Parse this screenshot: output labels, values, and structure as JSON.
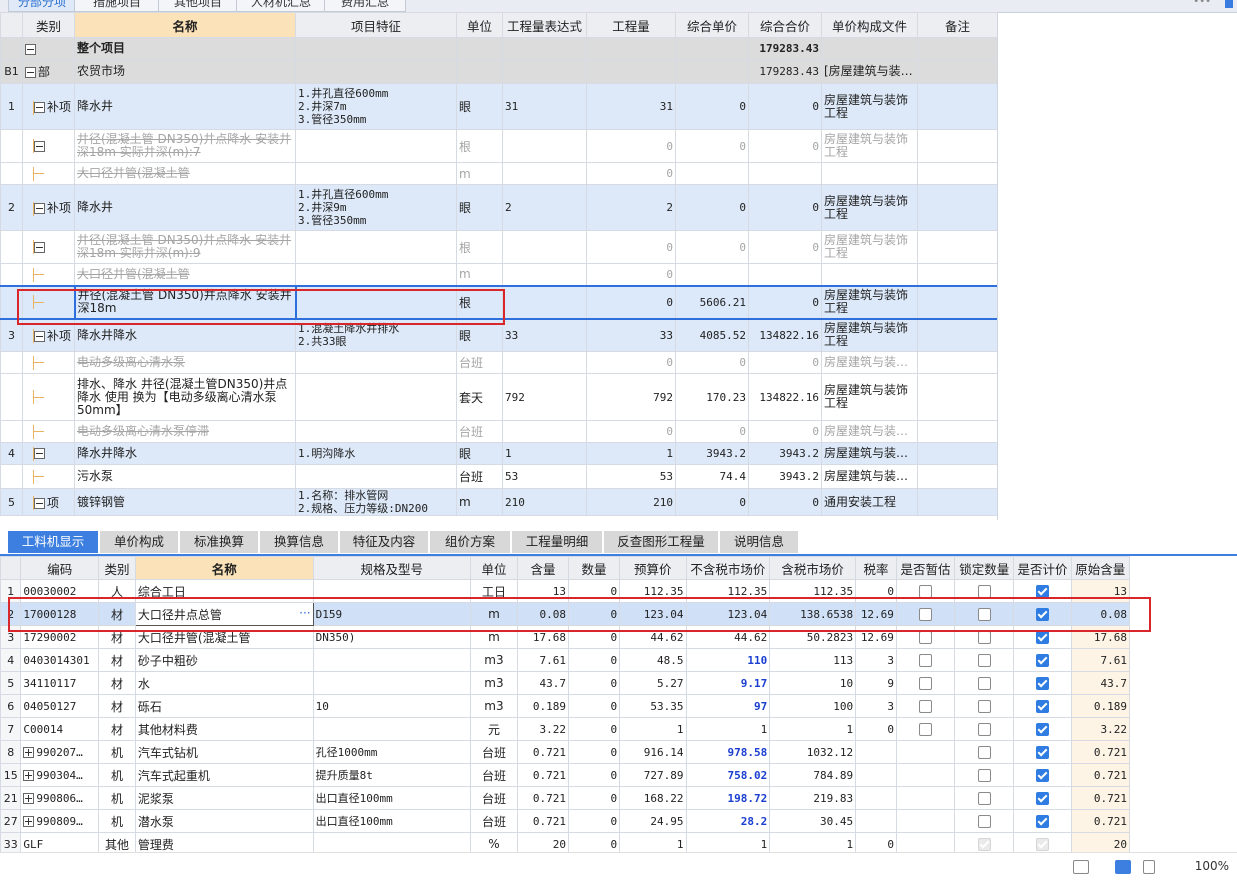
{
  "top_tabs": [
    "分部分项",
    "措施项目",
    "其他项目",
    "人材机汇总",
    "费用汇总"
  ],
  "upper": {
    "headers": [
      "类别",
      "名称",
      "项目特征",
      "单位",
      "工程量表达式",
      "工程量",
      "综合单价",
      "综合合价",
      "单价构成文件",
      "备注"
    ],
    "rows": [
      {
        "idx": "",
        "cat": "",
        "name": "整个项目",
        "feat": "",
        "unit": "",
        "expr": "",
        "qty": "",
        "price": "",
        "total": "179283.43",
        "file": "",
        "style": "gray"
      },
      {
        "idx": "B1",
        "cat": "部",
        "name": "农贸市场",
        "feat": "",
        "unit": "",
        "expr": "",
        "qty": "",
        "price": "",
        "total": "179283.43",
        "file": "[房屋建筑与装…",
        "style": "gray"
      },
      {
        "idx": "1",
        "cat": "补项",
        "name": "降水井",
        "feat": "1.井孔直径600mm\n2.井深7m\n3.管径350mm",
        "unit": "眼",
        "expr": "31",
        "qty": "31",
        "price": "0",
        "total": "0",
        "file": "房屋建筑与装饰工程",
        "style": "blue"
      },
      {
        "idx": "",
        "cat": "",
        "name": "井径(混凝土管 DN350)井点降水 安装井深18m  实际井深(m):7",
        "feat": "",
        "unit": "根",
        "expr": "",
        "qty": "0",
        "price": "0",
        "total": "0",
        "file": "房屋建筑与装饰工程",
        "style": "dis"
      },
      {
        "idx": "",
        "cat": "",
        "name": "大口径井管(混凝土管",
        "feat": "",
        "unit": "m",
        "expr": "",
        "qty": "0",
        "price": "",
        "total": "",
        "file": "",
        "style": "dis"
      },
      {
        "idx": "2",
        "cat": "补项",
        "name": "降水井",
        "feat": "1.井孔直径600mm\n2.井深9m\n3.管径350mm",
        "unit": "眼",
        "expr": "2",
        "qty": "2",
        "price": "0",
        "total": "0",
        "file": "房屋建筑与装饰工程",
        "style": "blue"
      },
      {
        "idx": "",
        "cat": "",
        "name": "井径(混凝土管 DN350)井点降水 安装井深18m  实际井深(m):9",
        "feat": "",
        "unit": "根",
        "expr": "",
        "qty": "0",
        "price": "0",
        "total": "0",
        "file": "房屋建筑与装饰工程",
        "style": "dis"
      },
      {
        "idx": "",
        "cat": "",
        "name": "大口径井管(混凝土管",
        "feat": "",
        "unit": "m",
        "expr": "",
        "qty": "0",
        "price": "",
        "total": "",
        "file": "",
        "style": "dis"
      },
      {
        "idx": "",
        "cat": "",
        "name": "井径(混凝土管 DN350)井点降水 安装井深18m",
        "feat": "",
        "unit": "根",
        "expr": "",
        "qty": "0",
        "price": "5606.21",
        "total": "0",
        "file": "房屋建筑与装饰工程",
        "style": "selrow"
      },
      {
        "idx": "3",
        "cat": "补项",
        "name": "降水井降水",
        "feat": "1.混凝土降水井排水\n2.共33眼",
        "unit": "眼",
        "expr": "33",
        "qty": "33",
        "price": "4085.52",
        "total": "134822.16",
        "file": "房屋建筑与装饰工程",
        "style": "blue"
      },
      {
        "idx": "",
        "cat": "",
        "name": "电动多级离心清水泵",
        "feat": "",
        "unit": "台班",
        "expr": "",
        "qty": "0",
        "price": "0",
        "total": "0",
        "file": "房屋建筑与装…",
        "style": "dis"
      },
      {
        "idx": "",
        "cat": "",
        "name": "排水、降水 井径(混凝土管DN350)井点降水 使用  换为【电动多级离心清水泵 50mm】",
        "feat": "",
        "unit": "套天",
        "expr": "792",
        "qty": "792",
        "price": "170.23",
        "total": "134822.16",
        "file": "房屋建筑与装饰工程",
        "style": "white"
      },
      {
        "idx": "",
        "cat": "",
        "name": "电动多级离心清水泵停滞",
        "feat": "",
        "unit": "台班",
        "expr": "",
        "qty": "0",
        "price": "0",
        "total": "0",
        "file": "房屋建筑与装…",
        "style": "dis"
      },
      {
        "idx": "4",
        "cat": "",
        "name": "降水井降水",
        "feat": "1.明沟降水",
        "unit": "眼",
        "expr": "1",
        "qty": "1",
        "price": "3943.2",
        "total": "3943.2",
        "file": "房屋建筑与装…",
        "style": "blue"
      },
      {
        "idx": "",
        "cat": "",
        "name": "污水泵",
        "feat": "",
        "unit": "台班",
        "expr": "53",
        "qty": "53",
        "price": "74.4",
        "total": "3943.2",
        "file": "房屋建筑与装…",
        "style": "white"
      },
      {
        "idx": "5",
        "cat": "项",
        "name": "镀锌钢管",
        "feat": "1.名称：排水管网\n2.规格、压力等级:DN200",
        "unit": "m",
        "expr": "210",
        "qty": "210",
        "price": "0",
        "total": "0",
        "file": "通用安装工程",
        "style": "blue"
      }
    ]
  },
  "bottom_tabs": [
    "工料机显示",
    "单价构成",
    "标准换算",
    "换算信息",
    "特征及内容",
    "组价方案",
    "工程量明细",
    "反查图形工程量",
    "说明信息"
  ],
  "lower": {
    "headers": [
      "编码",
      "类别",
      "名称",
      "规格及型号",
      "单位",
      "含量",
      "数量",
      "预算价",
      "不含税市场价",
      "含税市场价",
      "税率",
      "是否暂估",
      "锁定数量",
      "是否计价",
      "原始含量"
    ],
    "rows": [
      {
        "idx": "1",
        "code": "00030002",
        "cat": "人",
        "name": "综合工日",
        "spec": "",
        "unit": "工日",
        "content": "13",
        "qty": "0",
        "budget": "112.35",
        "ntax": "112.35",
        "tax": "112.35",
        "rate": "0",
        "est": false,
        "lock": false,
        "price": true,
        "orig": "13",
        "bold": false,
        "plus": false
      },
      {
        "idx": "2",
        "code": "17000128",
        "cat": "材",
        "name": "大口径井点总管",
        "spec": "D159",
        "unit": "m",
        "content": "0.08",
        "qty": "0",
        "budget": "123.04",
        "ntax": "123.04",
        "tax": "138.6538",
        "rate": "12.69",
        "est": false,
        "lock": false,
        "price": true,
        "orig": "0.08",
        "bold": false,
        "plus": false
      },
      {
        "idx": "3",
        "code": "17290002",
        "cat": "材",
        "name": "大口径井管(混凝土管",
        "spec": "DN350)",
        "unit": "m",
        "content": "17.68",
        "qty": "0",
        "budget": "44.62",
        "ntax": "44.62",
        "tax": "50.2823",
        "rate": "12.69",
        "est": false,
        "lock": false,
        "price": true,
        "orig": "17.68",
        "bold": false,
        "plus": false
      },
      {
        "idx": "4",
        "code": "0403014301",
        "cat": "材",
        "name": "砂子中粗砂",
        "spec": "",
        "unit": "m3",
        "content": "7.61",
        "qty": "0",
        "budget": "48.5",
        "ntax": "110",
        "tax": "113",
        "rate": "3",
        "est": false,
        "lock": false,
        "price": true,
        "orig": "7.61",
        "bold": true,
        "plus": false
      },
      {
        "idx": "5",
        "code": "34110117",
        "cat": "材",
        "name": "水",
        "spec": "",
        "unit": "m3",
        "content": "43.7",
        "qty": "0",
        "budget": "5.27",
        "ntax": "9.17",
        "tax": "10",
        "rate": "9",
        "est": false,
        "lock": false,
        "price": true,
        "orig": "43.7",
        "bold": true,
        "plus": false
      },
      {
        "idx": "6",
        "code": "04050127",
        "cat": "材",
        "name": "砾石",
        "spec": "10",
        "unit": "m3",
        "content": "0.189",
        "qty": "0",
        "budget": "53.35",
        "ntax": "97",
        "tax": "100",
        "rate": "3",
        "est": false,
        "lock": false,
        "price": true,
        "orig": "0.189",
        "bold": true,
        "plus": false
      },
      {
        "idx": "7",
        "code": "C00014",
        "cat": "材",
        "name": "其他材料费",
        "spec": "",
        "unit": "元",
        "content": "3.22",
        "qty": "0",
        "budget": "1",
        "ntax": "1",
        "tax": "1",
        "rate": "0",
        "est": false,
        "lock": false,
        "price": true,
        "orig": "3.22",
        "bold": false,
        "plus": false
      },
      {
        "idx": "8",
        "code": "990207…",
        "cat": "机",
        "name": "汽车式钻机",
        "spec": "孔径1000mm",
        "unit": "台班",
        "content": "0.721",
        "qty": "0",
        "budget": "916.14",
        "ntax": "978.58",
        "tax": "1032.12",
        "rate": "",
        "est": null,
        "lock": false,
        "price": true,
        "orig": "0.721",
        "bold": true,
        "plus": true
      },
      {
        "idx": "15",
        "code": "990304…",
        "cat": "机",
        "name": "汽车式起重机",
        "spec": "提升质量8t",
        "unit": "台班",
        "content": "0.721",
        "qty": "0",
        "budget": "727.89",
        "ntax": "758.02",
        "tax": "784.89",
        "rate": "",
        "est": null,
        "lock": false,
        "price": true,
        "orig": "0.721",
        "bold": true,
        "plus": true
      },
      {
        "idx": "21",
        "code": "990806…",
        "cat": "机",
        "name": "泥浆泵",
        "spec": "出口直径100mm",
        "unit": "台班",
        "content": "0.721",
        "qty": "0",
        "budget": "168.22",
        "ntax": "198.72",
        "tax": "219.83",
        "rate": "",
        "est": null,
        "lock": false,
        "price": true,
        "orig": "0.721",
        "bold": true,
        "plus": true
      },
      {
        "idx": "27",
        "code": "990809…",
        "cat": "机",
        "name": "潜水泵",
        "spec": "出口直径100mm",
        "unit": "台班",
        "content": "0.721",
        "qty": "0",
        "budget": "24.95",
        "ntax": "28.2",
        "tax": "30.45",
        "rate": "",
        "est": null,
        "lock": false,
        "price": true,
        "orig": "0.721",
        "bold": true,
        "plus": true
      },
      {
        "idx": "33",
        "code": "GLF",
        "cat": "其他",
        "name": "管理费",
        "spec": "",
        "unit": "%",
        "content": "20",
        "qty": "0",
        "budget": "1",
        "ntax": "1",
        "tax": "1",
        "rate": "0",
        "est": null,
        "lock": "faint",
        "price": "faint",
        "orig": "20",
        "bold": false,
        "plus": false
      }
    ]
  },
  "status": {
    "zoom": "100%"
  },
  "colors": {
    "accent": "#3c7fe0",
    "highlight": "#d9262b",
    "header_selected": "#fbe2b8"
  }
}
